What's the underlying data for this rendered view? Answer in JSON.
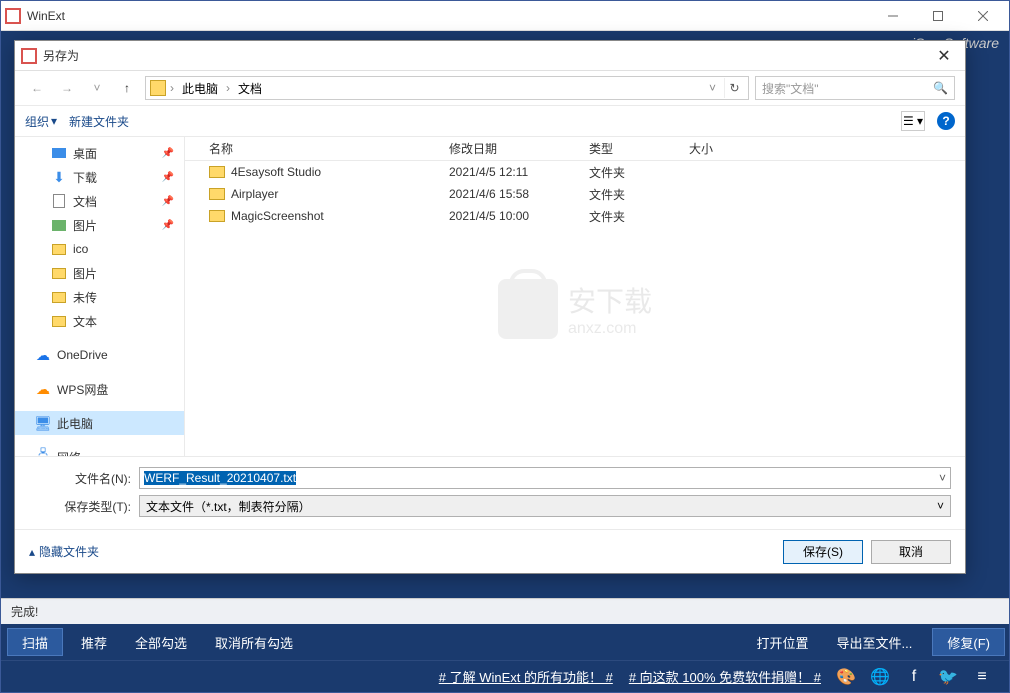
{
  "main_window": {
    "title": "WinExt",
    "brand": "iSun Software",
    "status": "完成!",
    "toolbar": {
      "scan": "扫描",
      "recommend": "推荐",
      "select_all": "全部勾选",
      "deselect_all": "取消所有勾选",
      "open_location": "打开位置",
      "export": "导出至文件...",
      "fix": "修复(F)"
    },
    "links": {
      "link1": "# 了解 WinExt 的所有功能！  #",
      "link2": "# 向这款 100% 免费软件捐赠！  #"
    }
  },
  "dialog": {
    "title": "另存为",
    "nav": {
      "crumb1": "此电脑",
      "crumb2": "文档",
      "search_placeholder": "搜索\"文档\""
    },
    "toolbar": {
      "organize": "组织",
      "new_folder": "新建文件夹"
    },
    "columns": {
      "name": "名称",
      "modified": "修改日期",
      "type": "类型",
      "size": "大小"
    },
    "sidebar": [
      {
        "label": "桌面",
        "icon": "desktop",
        "pinned": true,
        "level": 2
      },
      {
        "label": "下载",
        "icon": "download",
        "pinned": true,
        "level": 2
      },
      {
        "label": "文档",
        "icon": "doc",
        "pinned": true,
        "level": 2
      },
      {
        "label": "图片",
        "icon": "pic",
        "pinned": true,
        "level": 2
      },
      {
        "label": "ico",
        "icon": "folder",
        "pinned": false,
        "level": 2
      },
      {
        "label": "图片",
        "icon": "folder",
        "pinned": false,
        "level": 2
      },
      {
        "label": "未传",
        "icon": "folder",
        "pinned": false,
        "level": 2
      },
      {
        "label": "文本",
        "icon": "folder",
        "pinned": false,
        "level": 2
      },
      {
        "label": "OneDrive",
        "icon": "cloud",
        "pinned": false,
        "level": 1
      },
      {
        "label": "WPS网盘",
        "icon": "cloud2",
        "pinned": false,
        "level": 1
      },
      {
        "label": "此电脑",
        "icon": "pc",
        "pinned": false,
        "level": 1,
        "selected": true
      },
      {
        "label": "网络",
        "icon": "net",
        "pinned": false,
        "level": 1
      }
    ],
    "files": [
      {
        "name": "4Esaysoft Studio",
        "date": "2021/4/5 12:11",
        "type": "文件夹"
      },
      {
        "name": "Airplayer",
        "date": "2021/4/6 15:58",
        "type": "文件夹"
      },
      {
        "name": "MagicScreenshot",
        "date": "2021/4/5 10:00",
        "type": "文件夹"
      }
    ],
    "watermark": {
      "main": "安下载",
      "sub": "anxz.com"
    },
    "filename_label": "文件名(N):",
    "filename_value": "WERF_Result_20210407.txt",
    "filetype_label": "保存类型(T):",
    "filetype_value": "文本文件（*.txt，制表符分隔）",
    "hide_folders": "隐藏文件夹",
    "save_btn": "保存(S)",
    "cancel_btn": "取消"
  }
}
